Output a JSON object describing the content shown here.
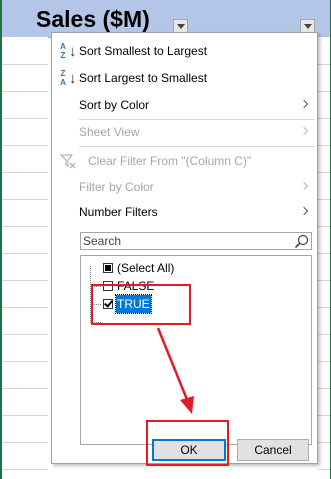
{
  "header": {
    "title": "Sales ($M)"
  },
  "menu": {
    "sort_asc": {
      "label": "Sort Smallest to Largest",
      "icon": "sort-ascending-icon",
      "letters_top": "A",
      "letters_bottom": "Z"
    },
    "sort_desc": {
      "label": "Sort Largest to Smallest",
      "icon": "sort-descending-icon",
      "letters_top": "Z",
      "letters_bottom": "A"
    },
    "sort_by_color": "Sort by Color",
    "sheet_view": "Sheet View",
    "clear_filter": "Clear Filter From \"(Column C)\"",
    "filter_by_color": "Filter by Color",
    "number_filters": "Number Filters"
  },
  "search": {
    "placeholder": "Search"
  },
  "list": [
    {
      "label": "(Select All)",
      "state": "partial"
    },
    {
      "label": "FALSE",
      "state": "unchecked"
    },
    {
      "label": "TRUE",
      "state": "checked"
    }
  ],
  "buttons": {
    "ok": "OK",
    "cancel": "Cancel"
  },
  "colors": {
    "header_bg": "#b4c6e7",
    "accent_blue": "#0078d7",
    "annotation_red": "#e31b23",
    "excel_green": "#217346"
  }
}
